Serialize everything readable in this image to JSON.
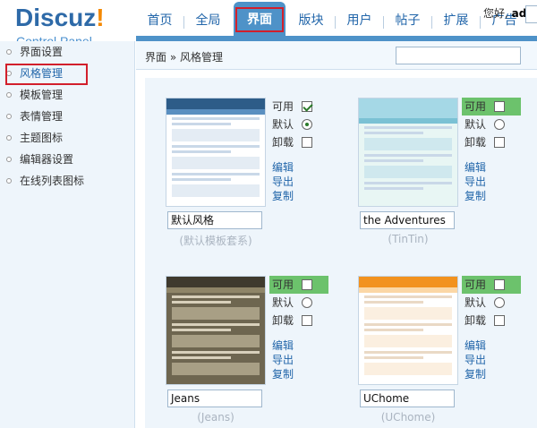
{
  "header": {
    "logo": {
      "main": "Discuz",
      "bang": "!",
      "sub": "Control Panel"
    },
    "nav": [
      "首页",
      "全局",
      "界面",
      "版块",
      "用户",
      "帖子",
      "扩展",
      "广告"
    ],
    "nav_active": "界面",
    "user_greeting": "您好,",
    "user_name": "adm"
  },
  "sidebar": {
    "items": [
      {
        "label": "界面设置"
      },
      {
        "label": "风格管理",
        "active": true
      },
      {
        "label": "模板管理"
      },
      {
        "label": "表情管理"
      },
      {
        "label": "主题图标"
      },
      {
        "label": "编辑器设置"
      },
      {
        "label": "在线列表图标"
      }
    ]
  },
  "breadcrumb": {
    "text": "界面 » 风格管理",
    "search_value": ""
  },
  "options": {
    "enabled_label": "可用",
    "default_label": "默认",
    "uninstall_label": "卸载"
  },
  "actions": {
    "edit": "编辑",
    "export": "导出",
    "copy": "复制"
  },
  "styles": [
    {
      "name": "默认风格",
      "template": "(默认模板套系)",
      "enabled": true,
      "default": true,
      "highlight": false
    },
    {
      "name": "the Adventures",
      "template": "(TinTin)",
      "enabled": false,
      "default": false,
      "highlight": true
    },
    {
      "name": "Jeans",
      "template": "(Jeans)",
      "enabled": false,
      "default": false,
      "highlight": true
    },
    {
      "name": "UChome",
      "template": "(UChome)",
      "enabled": false,
      "default": false,
      "highlight": true
    }
  ],
  "colors": {
    "brand_blue": "#2e6aa8",
    "brand_orange": "#f48800",
    "nav_active": "#4e92c8",
    "highlight_green": "#6cc26c",
    "annotation_red": "#d21f2b"
  }
}
